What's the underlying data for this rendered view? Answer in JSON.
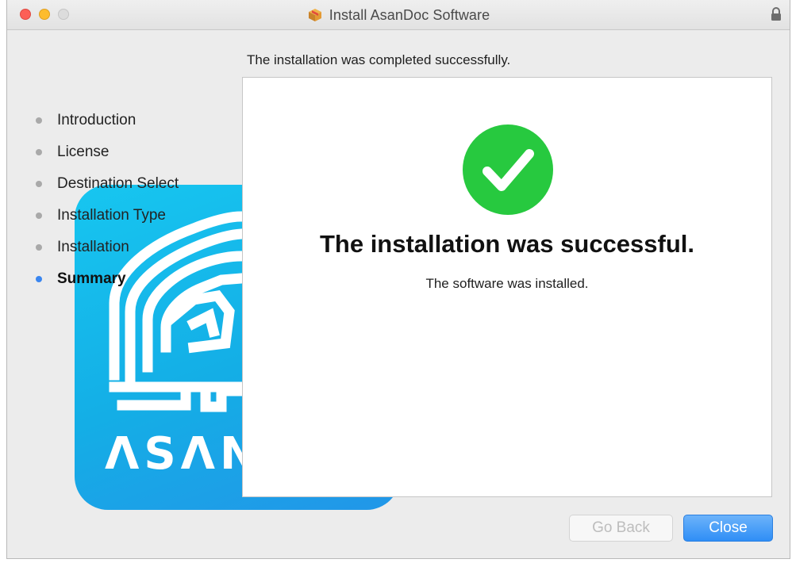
{
  "window": {
    "title": "Install AsanDoc Software"
  },
  "header": {
    "message": "The installation was completed successfully."
  },
  "sidebar": {
    "items": [
      {
        "label": "Introduction",
        "active": false
      },
      {
        "label": "License",
        "active": false
      },
      {
        "label": "Destination Select",
        "active": false
      },
      {
        "label": "Installation Type",
        "active": false
      },
      {
        "label": "Installation",
        "active": false
      },
      {
        "label": "Summary",
        "active": true
      }
    ]
  },
  "content": {
    "title": "The installation was successful.",
    "subtitle": "The software was installed."
  },
  "buttons": {
    "back_label": "Go Back",
    "close_label": "Close"
  },
  "icons": {
    "check": "checkmark-circle-icon",
    "package": "package-icon",
    "lock": "lock-icon"
  },
  "colors": {
    "accent": "#3a86f0",
    "success": "#27c93f",
    "logo_blue": "#14aee6"
  }
}
